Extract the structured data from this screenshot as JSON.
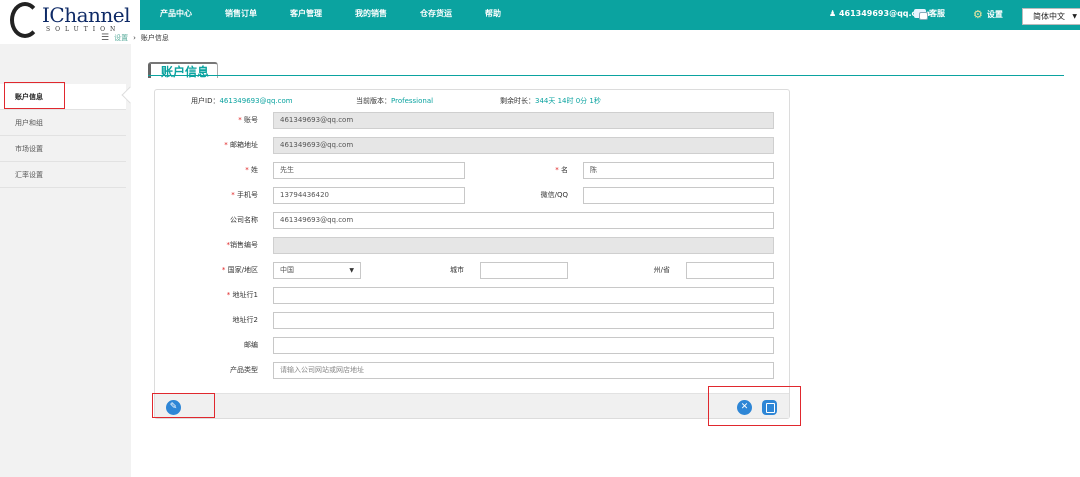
{
  "app": {
    "logo_main": "IChannel",
    "logo_sub": "SOLUTION"
  },
  "nav": [
    "产品中心",
    "销售订单",
    "客户管理",
    "我的销售",
    "仓存货运",
    "帮助"
  ],
  "header": {
    "user": "461349693@qq.com",
    "customer_service": "客服",
    "settings": "设置",
    "language": "简体中文"
  },
  "breadcrumb": {
    "root": "设置",
    "separator": "›",
    "current": "账户信息"
  },
  "sidebar": {
    "items": [
      {
        "label": "账户信息",
        "active": true
      },
      {
        "label": "用户和组",
        "active": false
      },
      {
        "label": "市场设置",
        "active": false
      },
      {
        "label": "汇率设置",
        "active": false
      }
    ]
  },
  "section_title": "账户信息",
  "account_info": {
    "user_id_label": "用户ID：",
    "user_id": "461349693@qq.com",
    "version_label": "当前版本：",
    "version": "Professional",
    "remaining_label": "剩余时长：",
    "remaining": "344天 14时 0分 1秒"
  },
  "form": {
    "account": {
      "label": "账号",
      "value": "461349693@qq.com",
      "required": true
    },
    "email": {
      "label": "邮箱地址",
      "value": "461349693@qq.com",
      "required": true
    },
    "last_name": {
      "label": "姓",
      "value": "先生",
      "required": true
    },
    "first_name": {
      "label": "名",
      "value": "陈",
      "required": true
    },
    "phone": {
      "label": "手机号",
      "value": "13794436420",
      "required": true
    },
    "wechat": {
      "label": "微信/QQ",
      "value": ""
    },
    "company": {
      "label": "公司名称",
      "value": "461349693@qq.com"
    },
    "sales_code": {
      "label": "销售编号",
      "value": "",
      "required": true
    },
    "country": {
      "label": "国家/地区",
      "value": "中国",
      "required": true
    },
    "city": {
      "label": "城市",
      "value": ""
    },
    "state": {
      "label": "州/省",
      "value": ""
    },
    "address1": {
      "label": "地址行1",
      "value": "",
      "required": true
    },
    "address2": {
      "label": "地址行2",
      "value": ""
    },
    "postcode": {
      "label": "邮编",
      "value": ""
    },
    "product_type": {
      "label": "产品类型",
      "placeholder": "请输入公司网站或网店地址"
    }
  },
  "required_mark": "*",
  "colors": {
    "brand": "#0ba3a0",
    "highlight_box": "#e0282e",
    "button": "#2e86d6"
  }
}
